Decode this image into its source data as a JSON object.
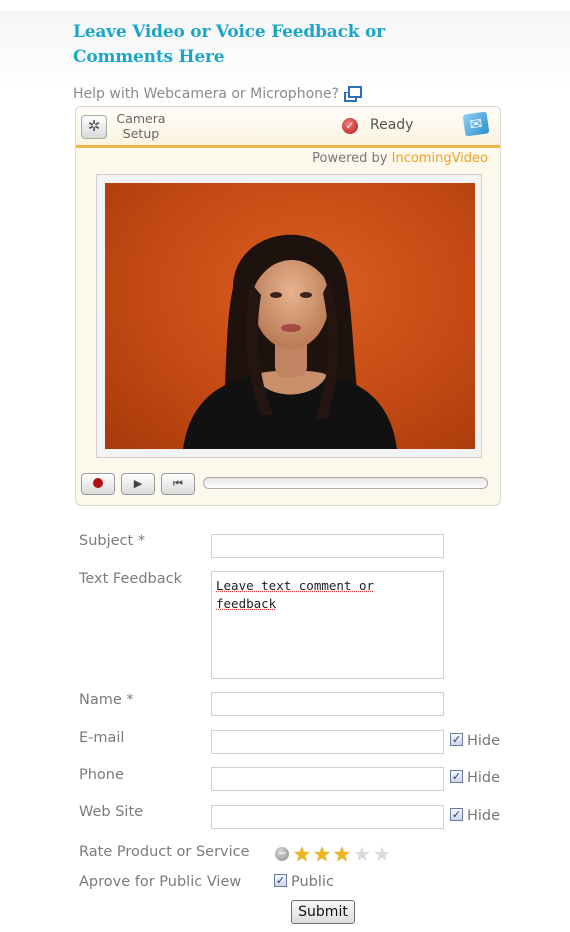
{
  "header": {
    "title": "Leave Video or Voice Feedback or Comments Here",
    "help_link": "Help with Webcamera or Microphone?"
  },
  "recorder": {
    "camera_setup_label": "Camera Setup",
    "status": "Ready",
    "powered_prefix": "Powered by ",
    "powered_brand": "IncomingVideo",
    "colors": {
      "accent": "#f0b54a",
      "brand": "#f0a020",
      "record": "#b01010"
    }
  },
  "form": {
    "subject_label": "Subject *",
    "text_feedback_label": "Text Feedback",
    "text_feedback_value": "Leave text comment or feedback",
    "name_label": "Name *",
    "email_label": "E-mail",
    "phone_label": "Phone",
    "website_label": "Web Site",
    "hide_label": "Hide",
    "rate_label": "Rate Product or Service",
    "rating": 3,
    "rating_max": 5,
    "approve_label": "Aprove for Public View",
    "public_label": "Public",
    "submit_label": "Submit"
  }
}
